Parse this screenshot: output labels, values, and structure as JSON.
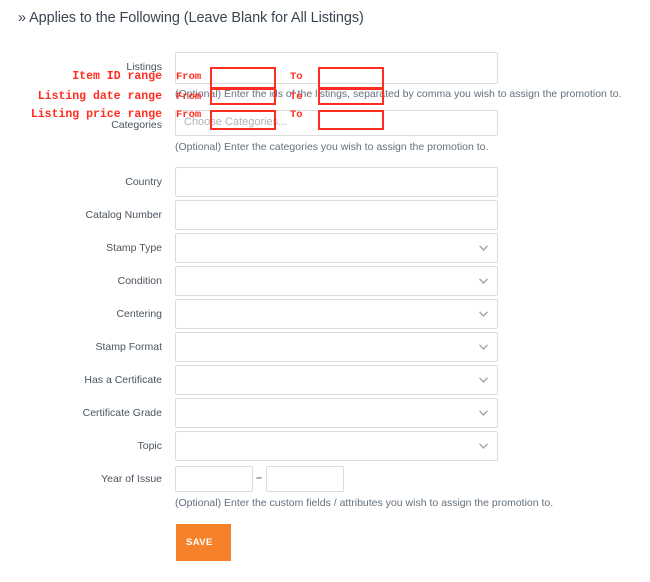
{
  "section": {
    "header": "» Applies to the Following (Leave Blank for All Listings)",
    "chevron_glyph": "»"
  },
  "form": {
    "listings": {
      "label": "Listings",
      "value": "",
      "placeholder": "",
      "helper": "(Optional) Enter the ids of the listings, separated by comma you wish to assign the promotion to."
    },
    "categories": {
      "label": "Categories",
      "placeholder": "Choose Categories...",
      "helper": "(Optional) Enter the categories you wish to assign the promotion to."
    },
    "fields": [
      {
        "label": "Country",
        "type": "text",
        "value": "",
        "placeholder": ""
      },
      {
        "label": "Catalog Number",
        "type": "text",
        "value": "",
        "placeholder": ""
      },
      {
        "label": "Stamp Type",
        "type": "select",
        "value": ""
      },
      {
        "label": "Condition",
        "type": "select",
        "value": ""
      },
      {
        "label": "Centering",
        "type": "select",
        "value": ""
      },
      {
        "label": "Stamp Format",
        "type": "select",
        "value": ""
      },
      {
        "label": "Has a Certificate",
        "type": "select",
        "value": ""
      },
      {
        "label": "Certificate Grade",
        "type": "select",
        "value": ""
      },
      {
        "label": "Topic",
        "type": "select",
        "value": ""
      }
    ],
    "year_of_issue": {
      "label": "Year of Issue",
      "from_value": "",
      "to_value": "",
      "separator": "–",
      "helper": "(Optional) Enter the custom fields / attributes you wish to assign the promotion to."
    },
    "save_label": "SAVE"
  },
  "annotations": {
    "accent_color": "#ff2d20",
    "from_label": "From",
    "to_label": "To",
    "rows": [
      {
        "label": "Item ID range"
      },
      {
        "label": "Listing date range"
      },
      {
        "label": "Listing price range"
      }
    ]
  },
  "colors": {
    "save_button": "#F5822A",
    "label_text": "#4a545e",
    "helper_text": "#63707c",
    "border": "#dcdcdc",
    "annotation_red": "#ff2d20"
  }
}
